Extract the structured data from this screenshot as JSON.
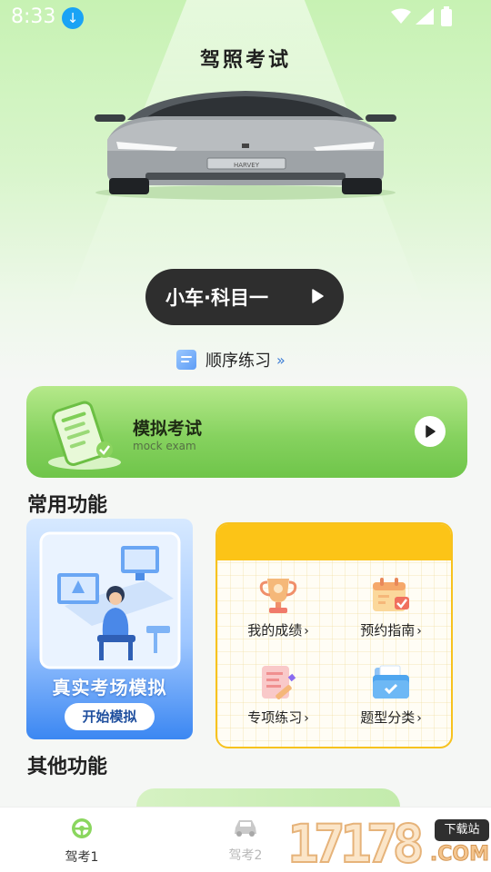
{
  "status_bar": {
    "time": "8:33"
  },
  "header": {
    "title": "驾照考试"
  },
  "hero": {
    "car_plate": "HARVEY",
    "subject_button": "小车·科目一"
  },
  "sequence_practice": {
    "label": "顺序练习"
  },
  "mock_exam": {
    "title": "模拟考试",
    "subtitle": "mock exam"
  },
  "common_functions": {
    "title": "常用功能",
    "exam_card": {
      "title": "真实考场模拟",
      "button": "开始模拟"
    },
    "grid": [
      {
        "label": "我的成绩",
        "icon": "trophy-icon"
      },
      {
        "label": "预约指南",
        "icon": "calendar-icon"
      },
      {
        "label": "专项练习",
        "icon": "notes-icon"
      },
      {
        "label": "题型分类",
        "icon": "folder-icon"
      }
    ]
  },
  "other_functions": {
    "title": "其他功能"
  },
  "tabbar": {
    "tabs": [
      {
        "label": "驾考1"
      },
      {
        "label": "驾考2"
      }
    ]
  },
  "watermark": {
    "digits": "17178",
    "tag": "下载站",
    "suffix": ".COM"
  },
  "colors": {
    "accent_green": "#6fc54a",
    "grid_yellow": "#fcc417",
    "exam_blue": "#3b87f2"
  }
}
